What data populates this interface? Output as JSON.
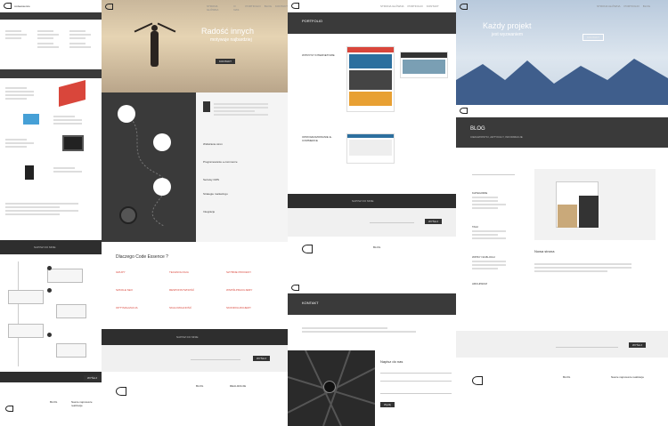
{
  "colors": {
    "dark": "#3a3a3a",
    "darker": "#2e2e2e",
    "accent": "#e8b04a",
    "light": "#f2f2f2",
    "sky": "#b8c9dc",
    "mountain": "#3f5e8c"
  },
  "brand": {
    "name": "codeessence"
  },
  "nav": [
    "STRONA GŁÓWNA",
    "O NAS",
    "PORTFOLIO",
    "BLOG",
    "KONTAKT",
    "PL"
  ],
  "hero": {
    "title": "Radość innych",
    "subtitle": "motywuje najbardziej",
    "button": "KONTAKT"
  },
  "hero2": {
    "title": "Każdy projekt",
    "subtitle": "jest wyzwaniem",
    "button": "KONTAKT"
  },
  "portfolio": {
    "title": "PORTFOLIO",
    "subtitle": "NASZE REALIZACJE",
    "item1": "WITRYNY INTERNETOWE",
    "item2": "OPROGRAMOWANIE E-COMMERCE"
  },
  "blog": {
    "title": "BLOG",
    "subtitle": "CIEKAWOSTKI, ARTYKUŁY, INFORMACJE",
    "post_title": "Nowa strona",
    "categories": "KATEGORIE",
    "tags": "TAGI",
    "archive": "ARCHIWUM",
    "recent": "WPISY NA BLOGU"
  },
  "contact": {
    "title": "KONTAKT",
    "form_title": "Napisz do nas",
    "send": "Wyślij"
  },
  "why": {
    "title": "Dlaczego Code Essence ?",
    "items": [
      "GRUPY",
      "TECHNOLOGIA",
      "SZYBKIE PROCESY",
      "SZKOLE SEO",
      "RESPONSYWNOŚĆ",
      "WSPÓŁPRACUJEMY",
      "OPTYMALIZACJA",
      "SKALOWALNOŚĆ",
      "SKONFIGURUJEMY"
    ]
  },
  "services": [
    "Wdrażanie stron",
    "Programowanie e-commerce",
    "Serwisy CMS",
    "Strategie marketingu",
    "Integracje"
  ],
  "newsletter": {
    "label": "NAPISZ DO MNIE",
    "button": "WYŚLIJ"
  },
  "footer": {
    "blog": "BLOG",
    "realizacje": "REALIZACJE",
    "najnowsze": "Nasze najnowsze realizacje"
  }
}
